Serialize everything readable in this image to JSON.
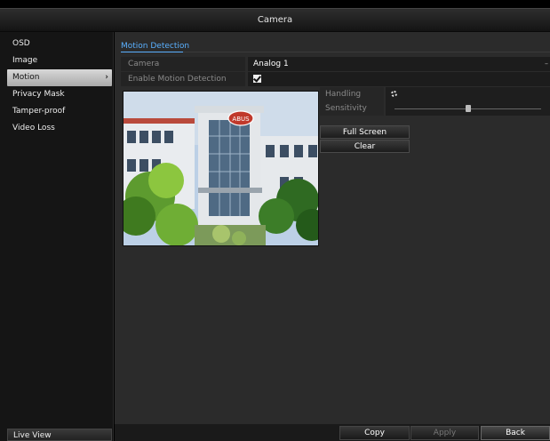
{
  "window": {
    "title": "Camera"
  },
  "sidebar": {
    "items": [
      {
        "label": "OSD"
      },
      {
        "label": "Image"
      },
      {
        "label": "Motion",
        "selected": true
      },
      {
        "label": "Privacy Mask"
      },
      {
        "label": "Tamper-proof"
      },
      {
        "label": "Video Loss"
      }
    ],
    "live_view": "Live View"
  },
  "main": {
    "tab": "Motion Detection",
    "camera_label": "Camera",
    "camera_value": "Analog 1",
    "enable_label": "Enable Motion Detection",
    "enable_checked": true,
    "handling_label": "Handling",
    "sensitivity_label": "Sensitivity",
    "sensitivity_level": 0.5,
    "full_screen": "Full Screen",
    "clear": "Clear",
    "preview_logo": "ABUS"
  },
  "footer": {
    "copy": "Copy",
    "apply": "Apply",
    "back": "Back"
  },
  "colors": {
    "accent": "#5ab0ff",
    "selected_bg": "#c8c8c8"
  }
}
